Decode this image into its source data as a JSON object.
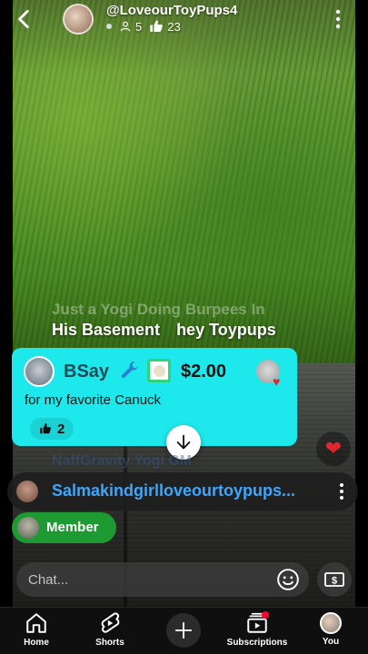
{
  "header": {
    "channel_name": "@LoveourToyPups4",
    "viewer_count": "5",
    "like_count": "23"
  },
  "chat": {
    "ghost_message_top": "Just a Yogi Doing Burpees In",
    "message_line": {
      "part1": "His Basement",
      "part2": "hey Toypups"
    },
    "ghost_message_bottom": "NaffGravity    Yogi GM"
  },
  "superchat": {
    "name": "BSay",
    "amount": "$2.00",
    "message": "for my favorite Canuck",
    "likes": "2",
    "background_color": "#1de9ec"
  },
  "pinned": {
    "name": "Salmakindgirlloveourtoypups..."
  },
  "member": {
    "label": "Member",
    "pill_color": "#1e9a33"
  },
  "chat_input": {
    "placeholder": "Chat..."
  },
  "bottom_nav": {
    "items": [
      {
        "label": "Home",
        "icon": "home-icon"
      },
      {
        "label": "Shorts",
        "icon": "shorts-icon"
      },
      {
        "label": "",
        "icon": "plus-icon"
      },
      {
        "label": "Subscriptions",
        "icon": "subscriptions-icon"
      },
      {
        "label": "You",
        "icon": "avatar"
      }
    ]
  }
}
